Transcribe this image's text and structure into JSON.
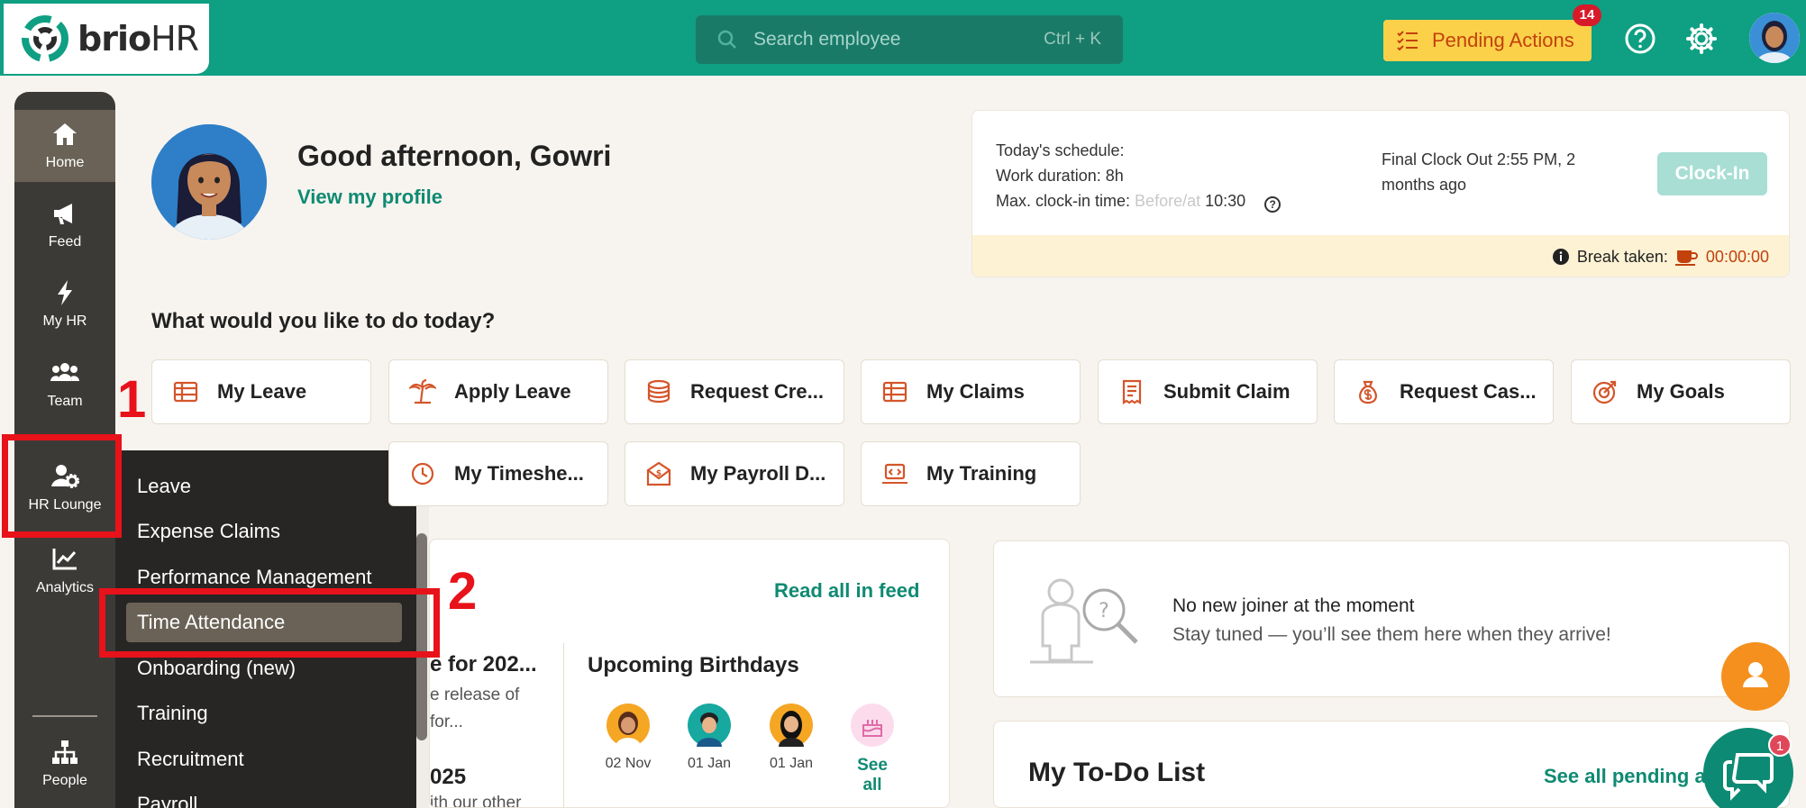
{
  "brand": {
    "name_part1": "brio",
    "name_part2": "HR"
  },
  "search": {
    "placeholder": "Search employee",
    "shortcut": "Ctrl + K"
  },
  "header": {
    "pending_label": "Pending Actions",
    "pending_count": "14"
  },
  "sidebar": {
    "items": [
      {
        "label": "Home",
        "icon": "home-icon"
      },
      {
        "label": "Feed",
        "icon": "megaphone-icon"
      },
      {
        "label": "My HR",
        "icon": "bolt-icon"
      },
      {
        "label": "Team",
        "icon": "team-icon"
      },
      {
        "label": "HR Lounge",
        "icon": "user-gear-icon"
      },
      {
        "label": "Analytics",
        "icon": "chart-icon"
      },
      {
        "label": "People",
        "icon": "org-chart-icon"
      }
    ]
  },
  "hr_menu": {
    "items": [
      "Leave",
      "Expense Claims",
      "Performance Management",
      "Time Attendance",
      "Onboarding (new)",
      "Training",
      "Recruitment",
      "Payroll"
    ],
    "highlighted": "Time Attendance"
  },
  "annotations": {
    "step1": "1",
    "step2": "2"
  },
  "profile": {
    "greeting": "Good afternoon, Gowri",
    "view_profile": "View my profile"
  },
  "schedule": {
    "todays_schedule": "Today's schedule:",
    "work_duration": "Work duration: 8h",
    "max_clockin_label": "Max. clock-in time:",
    "max_clockin_prefix": "Before/at",
    "max_clockin_value": "10:30",
    "final_clock_out": "Final Clock Out 2:55 PM, 2 months ago",
    "clockin_button": "Clock-In",
    "break_label": "Break taken:",
    "break_time": "00:00:00"
  },
  "quick_actions": {
    "heading": "What would you like to do today?",
    "row1": [
      "My Leave",
      "Apply Leave",
      "Request Cre...",
      "My Claims",
      "Submit Claim",
      "Request Cas...",
      "My Goals"
    ],
    "row2": [
      "My Timeshe...",
      "My Payroll D...",
      "My Training"
    ]
  },
  "news": {
    "read_all": "Read all in feed",
    "title_fragment": "e for 202...",
    "line1": "e release of",
    "line2": "for...",
    "line3": "025",
    "line4": "ith our other"
  },
  "birthdays": {
    "title": "Upcoming Birthdays",
    "dates": [
      "02 Nov",
      "01 Jan",
      "01 Jan"
    ],
    "see_all": "See all"
  },
  "joiners": {
    "title": "No new joiner at the moment",
    "subtitle": "Stay tuned — you’ll see them here when they arrive!"
  },
  "todo": {
    "title": "My To-Do List",
    "see_all_pending": "See all pending ac"
  },
  "chat": {
    "unread": "1"
  },
  "colors": {
    "brand_green": "#0f9f83",
    "accent_yellow": "#fcd14a",
    "annotation_red": "#e8121a",
    "sidebar_dark": "#3c3a37"
  }
}
